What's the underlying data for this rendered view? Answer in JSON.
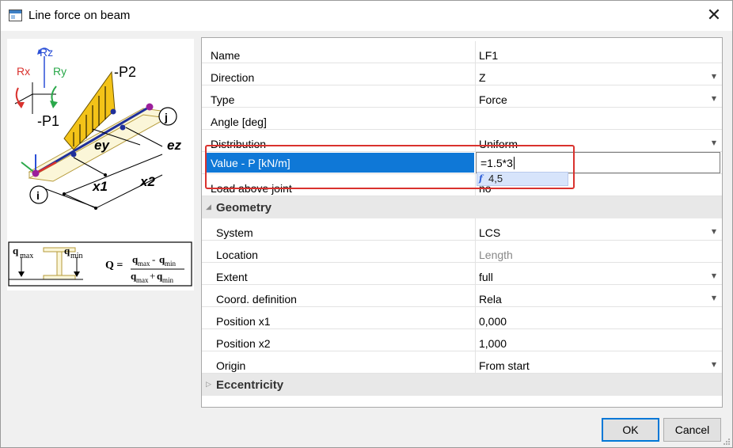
{
  "window": {
    "title": "Line force on beam",
    "close_glyph": "✕"
  },
  "picture": {
    "labels": {
      "rz": "Rz",
      "rx": "Rx",
      "ry": "Ry",
      "p2": "-P2",
      "p1": "-P1",
      "ey": "ey",
      "ez": "ez",
      "x1": "x1",
      "x2": "x2",
      "i": "i",
      "j": "j"
    },
    "section": {
      "qmax": "q",
      "qmax_sub": "max",
      "qmin": "q",
      "qmin_sub": "min",
      "formula": "Q ="
    },
    "colors": {
      "load_fill": "#f3c318",
      "beam": "#1f2f9a",
      "node_i": "#9b1f9b",
      "node_j": "#9b1f9b",
      "rx": "#d9322e",
      "ry": "#2aa84a",
      "rz": "#2a4fd7"
    }
  },
  "grid": {
    "rows": [
      {
        "name": "Name",
        "value": "LF1",
        "dropdown": false
      },
      {
        "name": "Direction",
        "value": "Z",
        "dropdown": true
      },
      {
        "name": "Type",
        "value": "Force",
        "dropdown": true
      },
      {
        "name": "Angle [deg]",
        "value": "",
        "dropdown": false
      },
      {
        "name": "Distribution",
        "value": "Uniform",
        "dropdown": true
      },
      {
        "name": "Value - P [kN/m]",
        "value": "=1.5*3",
        "selected": true
      },
      {
        "name": "Load above joint",
        "value": "no",
        "dropdown": false
      }
    ],
    "geometry": {
      "label": "Geometry",
      "rows": [
        {
          "name": "System",
          "value": "LCS",
          "dropdown": true
        },
        {
          "name": "Location",
          "value": "Length",
          "dropdown": false,
          "disabled": true
        },
        {
          "name": "Extent",
          "value": "full",
          "dropdown": true
        },
        {
          "name": "Coord. definition",
          "value": "Rela",
          "dropdown": true
        },
        {
          "name": "Position x1",
          "value": "0,000",
          "dropdown": false
        },
        {
          "name": "Position x2",
          "value": "1,000",
          "dropdown": false
        },
        {
          "name": "Origin",
          "value": "From start",
          "dropdown": true
        }
      ]
    },
    "eccentricity": {
      "label": "Eccentricity"
    },
    "suggestion": {
      "value": "4,5"
    }
  },
  "buttons": {
    "ok": "OK",
    "cancel": "Cancel"
  },
  "accent": {
    "selection": "#0f78d7",
    "annotation_box": "#d9322e"
  }
}
